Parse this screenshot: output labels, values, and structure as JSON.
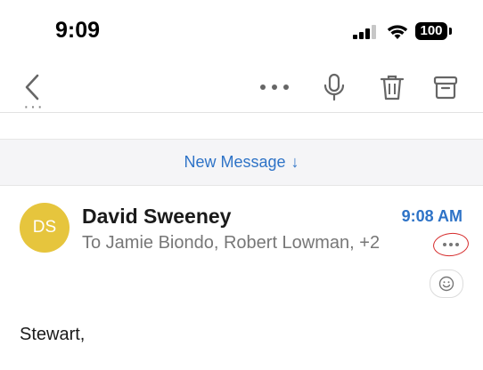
{
  "status_bar": {
    "time": "9:09",
    "battery": "100"
  },
  "toolbar": {
    "back_icon": "chevron-left-icon",
    "more_icon": "more-horizontal-icon",
    "mic_icon": "microphone-icon",
    "trash_icon": "trash-icon",
    "archive_icon": "archive-icon"
  },
  "thread": {
    "collapsed_indicator": "···"
  },
  "banner": {
    "label": "New Message",
    "arrow": "↓"
  },
  "message": {
    "avatar_initials": "DS",
    "avatar_color": "#e6c53d",
    "sender": "David Sweeney",
    "time": "9:08 AM",
    "recipients": "To Jamie Biondo, Robert Lowman, +2",
    "more_label": "···",
    "react_icon": "smiley-icon",
    "body_start": "Stewart,"
  },
  "colors": {
    "accent": "#2e73c7",
    "annotation_red": "#d62b2b"
  }
}
